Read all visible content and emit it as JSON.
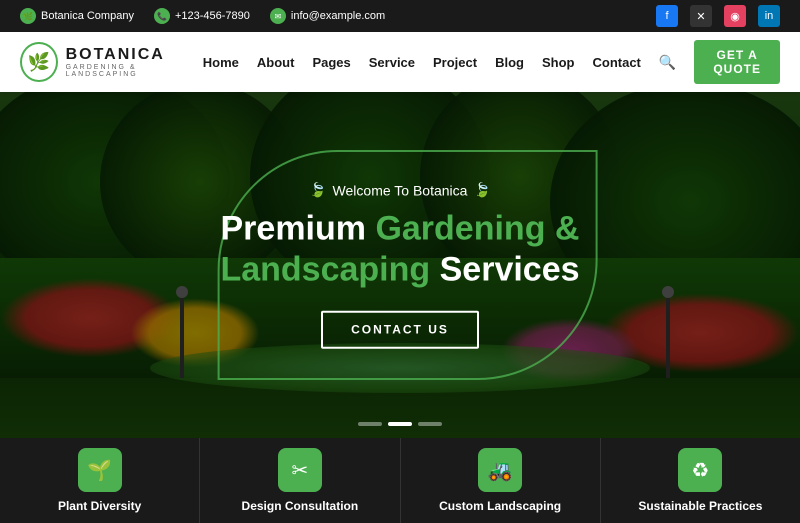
{
  "topbar": {
    "company": "Botanica Company",
    "phone": "+123-456-7890",
    "email": "info@example.com"
  },
  "navbar": {
    "logo_name": "BOTANICA",
    "logo_sub": "GARDENING & LANDSCAPING",
    "links": [
      "Home",
      "About",
      "Pages",
      "Service",
      "Project",
      "Blog",
      "Shop",
      "Contact"
    ],
    "cta": "GET A QUOTE"
  },
  "hero": {
    "welcome": "Welcome To Botanica",
    "title_line1_white": "Premium",
    "title_line1_green": "Gardening &",
    "title_line2_green": "Landscaping",
    "title_line2_white": "Services",
    "cta": "CONTACT US"
  },
  "cards": [
    {
      "icon": "🌱",
      "label": "Plant Diversity"
    },
    {
      "icon": "✂",
      "label": "Design Consultation"
    },
    {
      "icon": "🚜",
      "label": "Custom Landscaping"
    },
    {
      "icon": "♻",
      "label": "Sustainable Practices"
    }
  ],
  "social": [
    "f",
    "𝕏",
    "📷",
    "in"
  ]
}
